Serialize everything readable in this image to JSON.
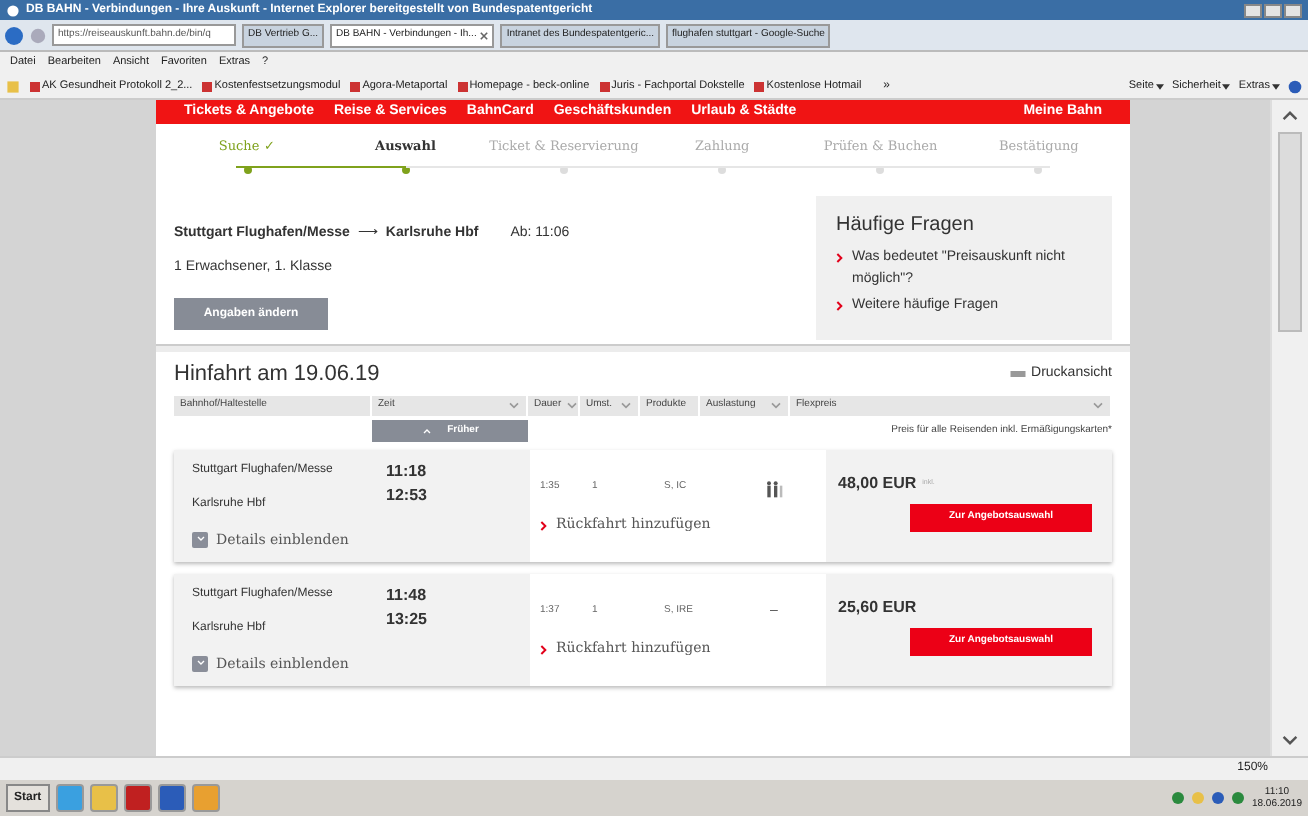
{
  "window": {
    "title": "DB BAHN - Verbindungen - Ihre Auskunft - Internet Explorer bereitgestellt von Bundespatentgericht"
  },
  "address": {
    "value": "https://reiseauskunft.bahn.de/bin/q"
  },
  "tabs": [
    {
      "label": "DB Vertrieb G...",
      "selected": false
    },
    {
      "label": "DB BAHN - Verbindungen - Ih...",
      "selected": true
    },
    {
      "label": "Intranet des Bundespatentgeric...",
      "selected": false
    },
    {
      "label": "flughafen stuttgart - Google-Suche",
      "selected": false
    }
  ],
  "menu": [
    "Datei",
    "Bearbeiten",
    "Ansicht",
    "Favoriten",
    "Extras",
    "?"
  ],
  "favorites": [
    "AK Gesundheit Protokoll 2_2...",
    "Kostenfestsetzungsmodul",
    "Agora-Metaportal",
    "Homepage - beck-online",
    "Juris - Fachportal Dokstelle",
    "Kostenlose Hotmail"
  ],
  "favorites_more": "»",
  "command_bar": [
    "Seite",
    "Sicherheit",
    "Extras"
  ],
  "site_nav": [
    "Tickets & Angebote",
    "Reise & Services",
    "BahnCard",
    "Geschäftskunden",
    "Urlaub & Städte",
    "Meine Bahn"
  ],
  "steps": [
    {
      "label": "Suche ✓",
      "completed": true,
      "selected": false
    },
    {
      "label": "Auswahl",
      "completed": true,
      "selected": true
    },
    {
      "label": "Ticket & Reservierung",
      "completed": false,
      "selected": false
    },
    {
      "label": "Zahlung",
      "completed": false,
      "selected": false
    },
    {
      "label": "Prüfen & Buchen",
      "completed": false,
      "selected": false
    },
    {
      "label": "Bestätigung",
      "completed": false,
      "selected": false
    }
  ],
  "summary": {
    "from": "Stuttgart Flughafen/Messe",
    "arrow": "⟶",
    "to": "Karlsruhe Hbf",
    "departure": "Ab: 11:06",
    "travellers": "1 Erwachsener, 1. Klasse",
    "button": "Angaben ändern"
  },
  "faq": {
    "title": "Häufige Fragen",
    "links": [
      "Was bedeutet \"Preisauskunft nicht möglich\"?",
      "Weitere häufige Fragen"
    ]
  },
  "results": {
    "title": "Hinfahrt am 19.06.19",
    "print": "Druckansicht",
    "columns": [
      {
        "label": "Bahnhof/Haltestelle",
        "sortable": false
      },
      {
        "label": "Zeit",
        "sortable": true
      },
      {
        "label": "Dauer",
        "sortable": true
      },
      {
        "label": "Umst.",
        "sortable": true
      },
      {
        "label": "Produkte",
        "sortable": false
      },
      {
        "label": "Auslastung",
        "sortable": true
      },
      {
        "label": "Flexpreis",
        "sortable": true
      }
    ],
    "earlier": "Früher",
    "price_note": "Preis für alle Reisenden inkl. Ermäßigungskarten*",
    "rows": [
      {
        "from": "Stuttgart Flughafen/Messe",
        "to": "Karlsruhe Hbf",
        "dep": "11:18",
        "arr": "12:53",
        "duration": "1:35",
        "changes": "1",
        "products": "S, IC",
        "occupancy": {
          "kind": "icon"
        },
        "price": "48,00 EUR",
        "price_badge": "inkl.",
        "details": "Details einblenden",
        "return": "Rückfahrt hinzufügen",
        "offer": "Zur Angebotsauswahl"
      },
      {
        "from": "Stuttgart Flughafen/Messe",
        "to": "Karlsruhe Hbf",
        "dep": "11:48",
        "arr": "13:25",
        "duration": "1:37",
        "changes": "1",
        "products": "S, IRE",
        "occupancy": {
          "kind": "text",
          "text": "–"
        },
        "price": "25,60 EUR",
        "details": "Details einblenden",
        "return": "Rückfahrt hinzufügen",
        "offer": "Zur Angebotsauswahl"
      }
    ]
  },
  "status_bar": {
    "zoom": "150%"
  },
  "taskbar": {
    "start": "Start",
    "time": "11:10",
    "date": "18.06.2019"
  }
}
